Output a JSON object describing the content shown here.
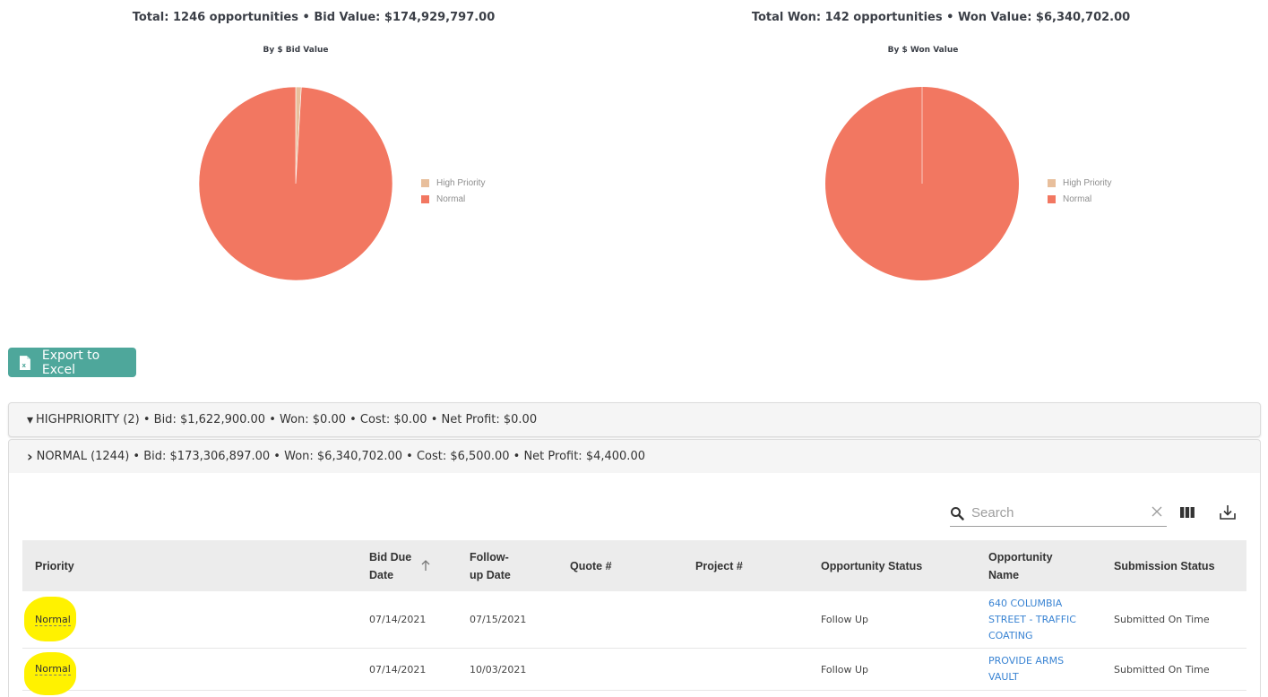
{
  "charts_section": {
    "bid": {
      "title": "Total: 1246 opportunities • Bid Value: $174,929,797.00",
      "subtitle": "By $ Bid Value"
    },
    "won": {
      "title": "Total Won: 142 opportunities • Won Value: $6,340,702.00",
      "subtitle": "By $ Won Value"
    }
  },
  "chart_data": [
    {
      "type": "pie",
      "title": "By $ Bid Value",
      "categories": [
        "High Priority",
        "Normal"
      ],
      "values": [
        1622900.0,
        173306897.0
      ],
      "colors": [
        "#e8bf9c",
        "#f27761"
      ],
      "legend_position": "right"
    },
    {
      "type": "pie",
      "title": "By $ Won Value",
      "categories": [
        "High Priority",
        "Normal"
      ],
      "values": [
        0.0,
        6340702.0
      ],
      "colors": [
        "#e8bf9c",
        "#f27761"
      ],
      "legend_position": "right"
    }
  ],
  "export_button": {
    "label": "Export to Excel",
    "icon": "excel-file-icon"
  },
  "groups": [
    {
      "expanded": true,
      "chevron": "▾",
      "text": "HIGHPRIORITY (2) • Bid: $1,622,900.00 • Won: $0.00 • Cost: $0.00 • Net Profit: $0.00"
    },
    {
      "expanded": false,
      "chevron": "›",
      "text": "NORMAL (1244) • Bid: $173,306,897.00 • Won: $6,340,702.00 • Cost: $6,500.00 • Net Profit: $4,400.00"
    }
  ],
  "table_toolbar": {
    "search_placeholder": "Search",
    "search_value": "",
    "icons": [
      "search-icon",
      "clear-icon",
      "view-columns-icon",
      "download-icon"
    ]
  },
  "table": {
    "columns": [
      {
        "label": "Priority"
      },
      {
        "label": "Bid Due Date",
        "sorted": "ascending"
      },
      {
        "label": "Follow-up Date"
      },
      {
        "label": "Quote #"
      },
      {
        "label": "Project #"
      },
      {
        "label": "Opportunity Status"
      },
      {
        "label": "Opportunity Name"
      },
      {
        "label": "Submission Status"
      }
    ],
    "rows": [
      {
        "priority": "Normal",
        "bid_due_date": "07/14/2021",
        "follow_up_date": "07/15/2021",
        "quote_no": "",
        "project_no": "",
        "opportunity_status": "Follow Up",
        "opportunity_name": "640 COLUMBIA STREET - TRAFFIC COATING",
        "submission_status": "Submitted On Time"
      },
      {
        "priority": "Normal",
        "bid_due_date": "07/14/2021",
        "follow_up_date": "10/03/2021",
        "quote_no": "",
        "project_no": "",
        "opportunity_status": "Follow Up",
        "opportunity_name": "PROVIDE ARMS VAULT",
        "submission_status": "Submitted On Time"
      }
    ]
  }
}
